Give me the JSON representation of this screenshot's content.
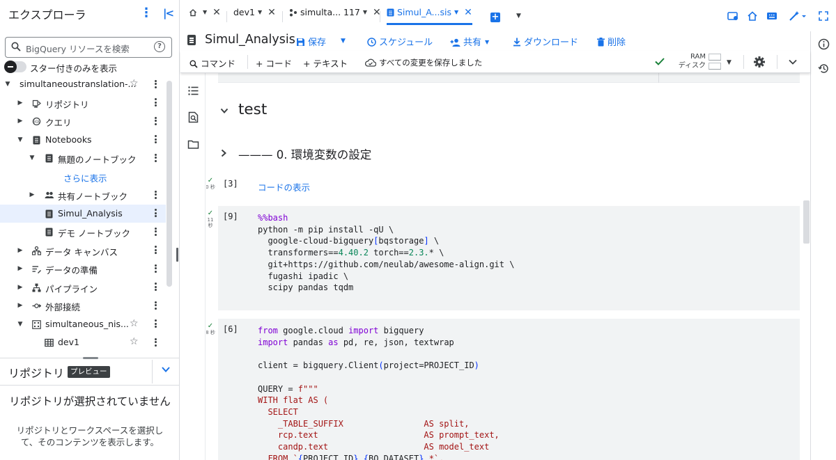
{
  "explorer": {
    "title": "エクスプローラ",
    "search_placeholder": "BigQuery リソースを検索",
    "starred_only": "スター付きのみを表示",
    "tree": [
      {
        "label": "simultaneoustranslation-...",
        "level": 0,
        "caret": "down",
        "icon": "",
        "starred": true
      },
      {
        "label": "リポジトリ",
        "level": 1,
        "caret": "right",
        "icon": "repository-icon"
      },
      {
        "label": "クエリ",
        "level": 1,
        "caret": "right",
        "icon": "query-icon"
      },
      {
        "label": "Notebooks",
        "level": 1,
        "caret": "down",
        "icon": "notebook-icon"
      },
      {
        "label": "無題のノートブック",
        "level": 2,
        "caret": "down",
        "icon": "notebook-icon"
      },
      {
        "label": "さらに表示",
        "level": 3,
        "caret": "",
        "icon": "",
        "link": true,
        "no_menu": true
      },
      {
        "label": "共有ノートブック",
        "level": 2,
        "caret": "right",
        "icon": "people-icon"
      },
      {
        "label": "Simul_Analysis",
        "level": 2,
        "caret": "",
        "icon": "notebook-icon",
        "selected": true
      },
      {
        "label": "デモ ノートブック",
        "level": 2,
        "caret": "",
        "icon": "notebook-icon"
      },
      {
        "label": "データ キャンバス",
        "level": 1,
        "caret": "right",
        "icon": "canvas-icon"
      },
      {
        "label": "データの準備",
        "level": 1,
        "caret": "right",
        "icon": "data-prep-icon"
      },
      {
        "label": "パイプライン",
        "level": 1,
        "caret": "right",
        "icon": "pipeline-icon"
      },
      {
        "label": "外部接続",
        "level": 1,
        "caret": "right",
        "icon": "connection-icon"
      },
      {
        "label": "simultaneous_nis...",
        "level": 1,
        "caret": "down",
        "icon": "dataset-icon",
        "starred": true
      },
      {
        "label": "dev1",
        "level": 2,
        "caret": "",
        "icon": "table-icon",
        "starred": true
      }
    ]
  },
  "repo_panel": {
    "title": "リポジトリ",
    "badge": "プレビュー",
    "empty_title": "リポジトリが選択されていません",
    "empty_desc": "リポジトリとワークスペースを選択して、そのコンテンツを表示します。"
  },
  "tabs": [
    {
      "label": "",
      "icon": "home-icon",
      "has_dropdown": true,
      "closable": true
    },
    {
      "label": "dev1",
      "icon": "",
      "has_dropdown": true,
      "closable": true
    },
    {
      "label": "simulta... 117",
      "icon": "query-tab-icon",
      "has_dropdown": true,
      "closable": true
    },
    {
      "label": "Simul_A...sis",
      "icon": "notebook-icon",
      "has_dropdown": true,
      "closable": true,
      "active": true
    }
  ],
  "notebook": {
    "name": "Simul_Analysis",
    "actions": {
      "save": "保存",
      "schedule": "スケジュール",
      "share": "共有",
      "download": "ダウンロード",
      "delete": "削除"
    }
  },
  "toolbar": {
    "commands": "コマンド",
    "code": "+ コード",
    "text": "+ テキスト",
    "saved_status": "すべての変更を保存しました",
    "ram": "RAM",
    "disk": "ディスク"
  },
  "content": {
    "heading": "test",
    "subheading": "——— 0. 環境変数の設定",
    "cells": [
      {
        "count": "[3]",
        "status_time": "0 秒",
        "show_code": "コードの表示"
      },
      {
        "count": "[9]",
        "status_time": "11 秒"
      },
      {
        "count": "[6]",
        "status_time": "8 秒"
      }
    ]
  },
  "colors": {
    "accent": "#1a73e8",
    "selected_row": "#e8f0fe",
    "code_bg": "#f1f3f4",
    "keyword": "#7f00d4",
    "string": "#a31515",
    "number": "#098658",
    "success": "#188038"
  }
}
